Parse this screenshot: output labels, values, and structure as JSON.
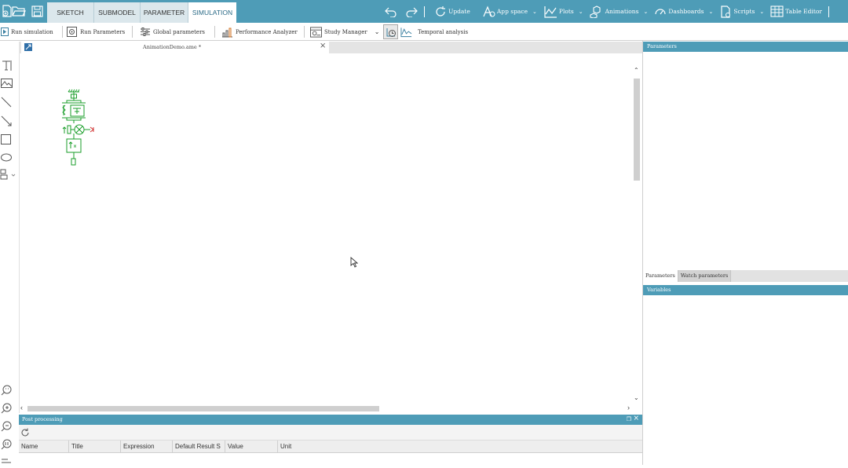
{
  "top_bar": {
    "tabs": [
      {
        "label": "SKETCH",
        "active": false
      },
      {
        "label": "SUBMODEL",
        "active": false
      },
      {
        "label": "PARAMETER",
        "active": false
      },
      {
        "label": "SIMULATION",
        "active": true
      }
    ],
    "actions": {
      "update": "Update",
      "app_space": "App space",
      "plots": "Plots",
      "animations": "Animations",
      "dashboards": "Dashboards",
      "scripts": "Scripts",
      "table_editor": "Table Editor"
    }
  },
  "sim_toolbar": {
    "run_simulation": "Run simulation",
    "run_parameters": "Run Parameters",
    "global_parameters": "Global parameters",
    "performance_analyzer": "Performance Analyzer",
    "study_manager": "Study Manager",
    "temporal_analysis": "Temporal analysis"
  },
  "document": {
    "tab_title": "AnimationDemo.ame *"
  },
  "post_processing": {
    "title": "Post processing",
    "columns": [
      "Name",
      "Title",
      "Expression",
      "Default Result S",
      "Value",
      "Unit"
    ]
  },
  "right_panel": {
    "parameters_title": "Parameters",
    "tabs": [
      {
        "label": "Parameters",
        "active": true
      },
      {
        "label": "Watch parameters",
        "active": false
      }
    ],
    "variables_title": "Variables"
  },
  "colors": {
    "accent": "#4e9cb7",
    "diagram": "#1a9e2a",
    "arrow": "#d03030"
  }
}
